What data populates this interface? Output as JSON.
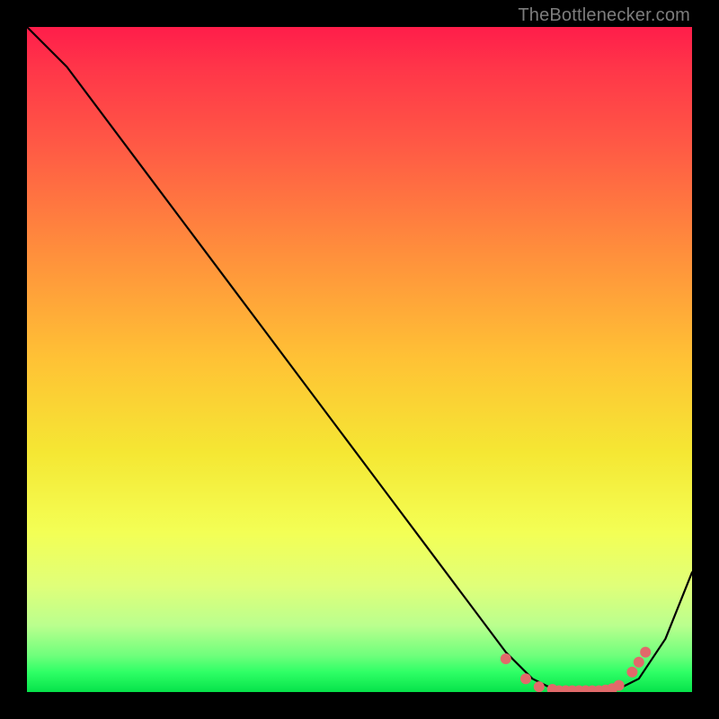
{
  "attribution": "TheBottlenecker.com",
  "colors": {
    "background": "#000000",
    "curve": "#000000",
    "marker": "#e16a6a",
    "gradient_top": "#ff1d4a",
    "gradient_bottom": "#06e24a"
  },
  "chart_data": {
    "type": "line",
    "title": "",
    "xlabel": "",
    "ylabel": "",
    "xlim": [
      0,
      100
    ],
    "ylim": [
      0,
      100
    ],
    "grid": false,
    "legend": false,
    "series": [
      {
        "name": "bottleneck-curve",
        "x": [
          0,
          6,
          12,
          18,
          24,
          30,
          36,
          42,
          48,
          54,
          60,
          66,
          72,
          76,
          80,
          84,
          88,
          92,
          96,
          100
        ],
        "y": [
          100,
          94,
          86,
          78,
          70,
          62,
          54,
          46,
          38,
          30,
          22,
          14,
          6,
          2,
          0,
          0,
          0,
          2,
          8,
          18
        ]
      }
    ],
    "markers": {
      "name": "highlighted-points",
      "x": [
        72,
        75,
        77,
        79,
        80,
        81,
        82,
        83,
        84,
        85,
        86,
        87,
        88,
        89,
        91,
        92,
        93
      ],
      "y": [
        5,
        2,
        0.8,
        0.4,
        0.2,
        0.2,
        0.2,
        0.2,
        0.2,
        0.2,
        0.2,
        0.3,
        0.5,
        1,
        3,
        4.5,
        6
      ]
    }
  }
}
